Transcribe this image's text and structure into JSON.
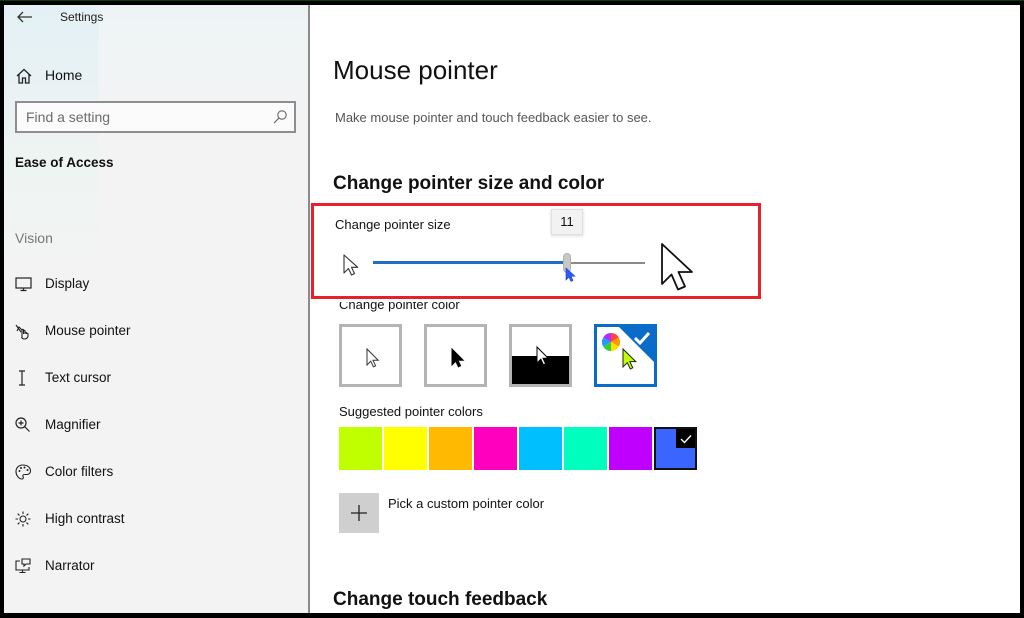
{
  "window": {
    "app_title": "Settings"
  },
  "sidebar": {
    "home_label": "Home",
    "search": {
      "placeholder": "Find a setting",
      "value": ""
    },
    "section_title": "Ease of Access",
    "group_label": "Vision",
    "items": [
      {
        "label": "Display",
        "icon": "monitor-icon"
      },
      {
        "label": "Mouse pointer",
        "icon": "mouse-pointer-hand-icon"
      },
      {
        "label": "Text cursor",
        "icon": "text-cursor-icon"
      },
      {
        "label": "Magnifier",
        "icon": "magnifier-icon"
      },
      {
        "label": "Color filters",
        "icon": "palette-icon"
      },
      {
        "label": "High contrast",
        "icon": "sun-icon"
      },
      {
        "label": "Narrator",
        "icon": "narrator-icon"
      }
    ]
  },
  "main": {
    "title": "Mouse pointer",
    "description": "Make mouse pointer and touch feedback easier to see.",
    "section_pointer": "Change pointer size and color",
    "pointer_size": {
      "label": "Change pointer size",
      "min": 1,
      "max": 15,
      "value": 11,
      "tooltip": "11"
    },
    "pointer_color": {
      "label": "Change pointer color",
      "options": [
        {
          "name": "white",
          "selected": false
        },
        {
          "name": "black",
          "selected": false
        },
        {
          "name": "inverted",
          "selected": false
        },
        {
          "name": "custom",
          "selected": true
        }
      ]
    },
    "suggested": {
      "label": "Suggested pointer colors",
      "colors": [
        "#BFFF00",
        "#FFFF00",
        "#FFB900",
        "#FF00BF",
        "#00BFFF",
        "#00FFBF",
        "#BF00FF",
        "#3A66FF"
      ],
      "selected_index": 7
    },
    "custom_color_label": "Pick a custom pointer color",
    "section_touch": "Change touch feedback"
  },
  "colors": {
    "accent": "#0A6CC8",
    "slider_fill": "#1E6FBF",
    "highlight_annotation": "#E8202A"
  }
}
